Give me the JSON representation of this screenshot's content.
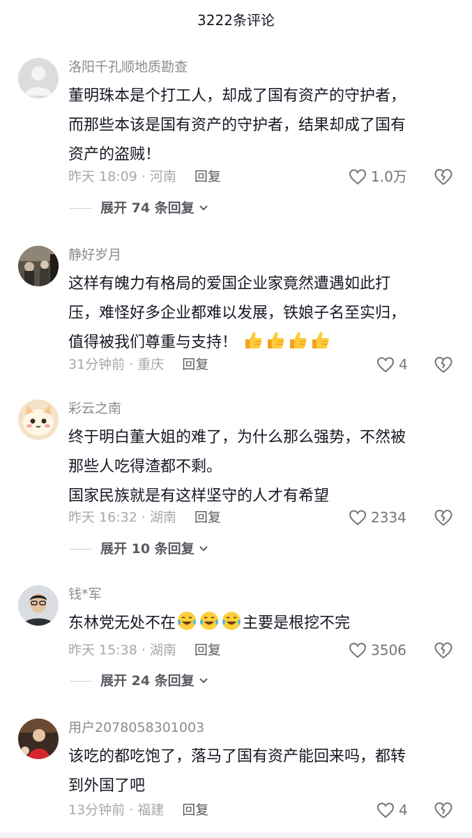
{
  "header": {
    "title": "3222条评论"
  },
  "reply_label": "回复",
  "comments": [
    {
      "username": "洛阳千孔顺地质勘查",
      "lines": [
        "董明珠本是个打工人，却成了国有资产的守护者，",
        "而那些本该是国有资产的守护者，结果却成了国有",
        "资产的盗贼！"
      ],
      "time": "昨天 18:09 · 河南",
      "likes": "1.0万",
      "expand": "展开 74 条回复"
    },
    {
      "username": "静好岁月",
      "lines": [
        "这样有魄力有格局的爱国企业家竟然遭遇如此打",
        "压，难怪好多企业都难以发展，铁娘子名至实归，",
        "值得被我们尊重与支持！"
      ],
      "emoji": "thumbs-up-emoji",
      "time": "31分钟前 · 重庆",
      "likes": "4"
    },
    {
      "username": "彩云之南",
      "lines": [
        "终于明白董大姐的难了，为什么那么强势，不然被",
        "那些人吃得渣都不剩。",
        "国家民族就是有这样坚守的人才有希望"
      ],
      "time": "昨天 16:32 · 湖南",
      "likes": "2334",
      "expand": "展开 10 条回复"
    },
    {
      "username": "钱*军",
      "text_before": "东林党无处不在",
      "emoji": "crying-laughing-emoji",
      "text_after": "主要是根挖不完",
      "time": "昨天 15:38 · 湖南",
      "likes": "3506",
      "expand": "展开 24 条回复"
    },
    {
      "username": "用户2078058301003",
      "lines": [
        "该吃的都吃饱了，落马了国有资产能回来吗，都转",
        "到外国了吧"
      ],
      "time": "13分钟前 · 福建",
      "likes": "4"
    }
  ]
}
